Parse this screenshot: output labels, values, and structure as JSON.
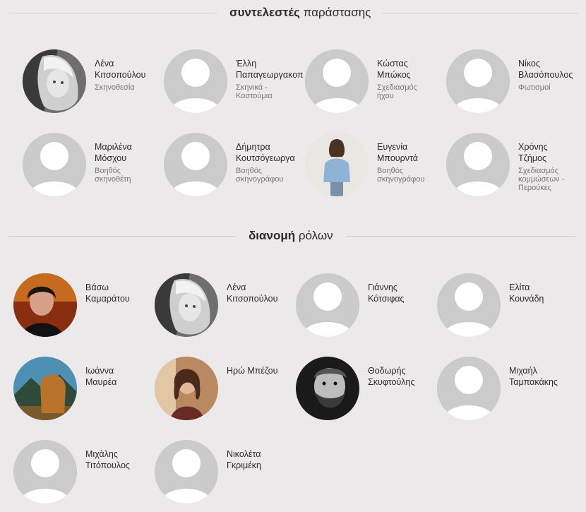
{
  "crew_section": {
    "title_bold": "συντελεστές",
    "title_light": "παράστασης",
    "people": [
      {
        "name": "Λένα\nΚιτσοπούλου",
        "role": "Σκηνοθεσία",
        "avatar": "photo-blonde-woman"
      },
      {
        "name": "Έλλη\nΠαπαγεωργακοπ",
        "role": "Σκηνικά -\nΚοστούμια",
        "avatar": "placeholder-person-icon"
      },
      {
        "name": "Κώστας\nΜπώκος",
        "role": "Σχεδιασμός\nήχου",
        "avatar": "placeholder-person-icon"
      },
      {
        "name": "Νίκος\nΒλασόπουλος",
        "role": "Φωτισμοί",
        "avatar": "placeholder-person-icon"
      },
      {
        "name": "Μαριλένα\nΜόσχου",
        "role": "Βοηθός\nσκηνοθέτη",
        "avatar": "placeholder-person-icon"
      },
      {
        "name": "Δήμητρα\nΚουτσόγεωργα",
        "role": "Βοηθός\nσκηνογράφου",
        "avatar": "placeholder-person-icon"
      },
      {
        "name": "Ευγενία\nΜπουρντά",
        "role": "Βοηθός\nσκηνογράφου",
        "avatar": "photo-woman-denim-shirt"
      },
      {
        "name": "Χρόνης\nΤζήμος",
        "role": "Σχεδιασμός\nκομμώσεων -\nΠερούκες",
        "avatar": "placeholder-person-icon"
      }
    ]
  },
  "cast_section": {
    "title_bold": "διανομή",
    "title_light": "ρόλων",
    "people": [
      {
        "name": "Βάσω\nΚαμαράτου",
        "avatar": "photo-woman-dark-red"
      },
      {
        "name": "Λένα\nΚιτσοπούλου",
        "avatar": "photo-blonde-woman"
      },
      {
        "name": "Γιάννης\nΚότσιφας",
        "avatar": "placeholder-person-icon"
      },
      {
        "name": "Ελίτα\nΚουνάδη",
        "avatar": "placeholder-person-icon"
      },
      {
        "name": "Ιωάννα\nΜαυρέα",
        "avatar": "photo-woman-mountains"
      },
      {
        "name": "Ηρώ Μπέζου",
        "avatar": "photo-woman-brown-hair"
      },
      {
        "name": "Θοδωρής\nΣκυφτούλης",
        "avatar": "photo-man-bw-beard"
      },
      {
        "name": "Μιχαήλ\nΤαμπακάκης",
        "avatar": "placeholder-person-icon"
      },
      {
        "name": "Μιχάλης\nΤιτόπουλος",
        "avatar": "placeholder-person-icon"
      },
      {
        "name": "Νικολέτα\nΓκριμέκη",
        "avatar": "placeholder-person-icon"
      }
    ]
  }
}
